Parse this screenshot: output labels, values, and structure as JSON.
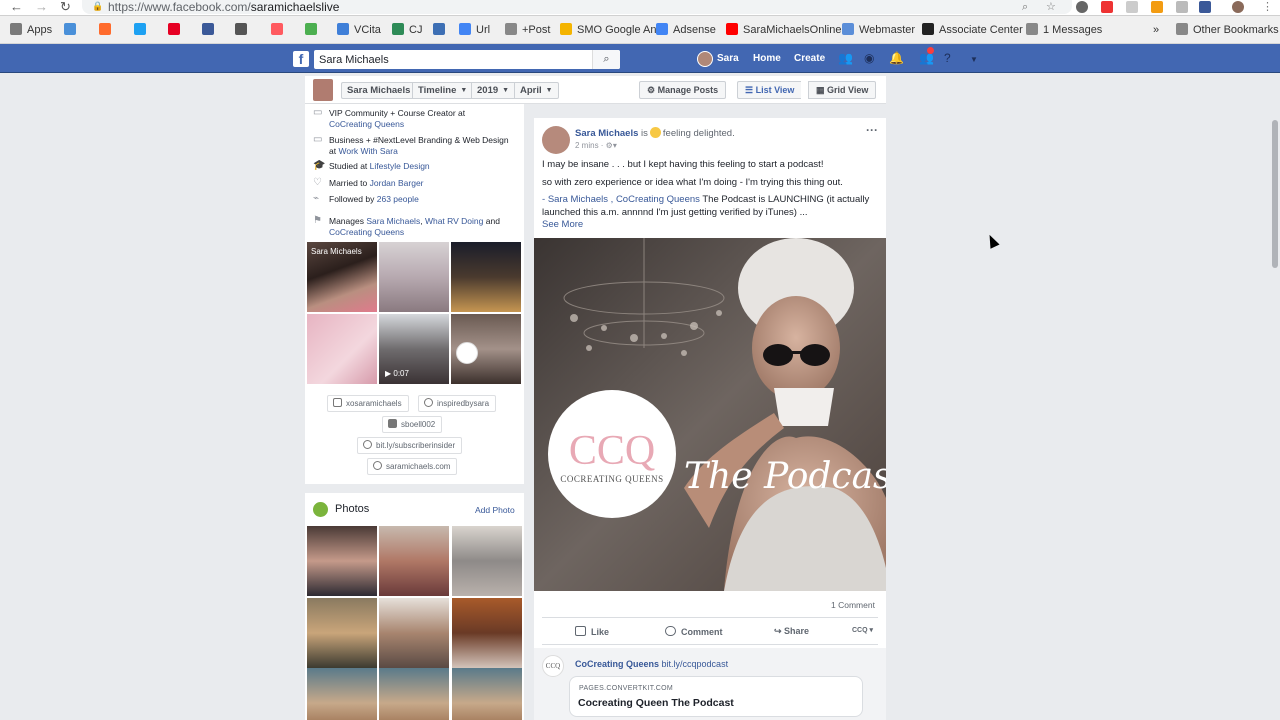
{
  "browser": {
    "url_prefix": "https://www.facebook.com/",
    "url_path": "saramichaelslive",
    "bookmarks": [
      {
        "label": "Apps",
        "color": "#7a7a7a"
      },
      {
        "label": "",
        "color": "#4a90d9"
      },
      {
        "label": "",
        "color": "#ff6b2c"
      },
      {
        "label": "",
        "color": "#1da1f2"
      },
      {
        "label": "",
        "color": "#e60023"
      },
      {
        "label": "",
        "color": "#3b5998"
      },
      {
        "label": "",
        "color": "#555555"
      },
      {
        "label": "",
        "color": "#ff5a5f"
      },
      {
        "label": "",
        "color": "#4caf50"
      },
      {
        "label": "VCita",
        "color": "#3f7fd8"
      },
      {
        "label": "CJ",
        "color": "#2e8b57"
      },
      {
        "label": "",
        "color": "#3d6fb4"
      },
      {
        "label": "Url",
        "color": "#4285f4"
      },
      {
        "label": "+Post",
        "color": "#888888"
      },
      {
        "label": "SMO Google An",
        "color": "#f4b400"
      },
      {
        "label": "Adsense",
        "color": "#4285f4"
      },
      {
        "label": "SaraMichaelsOnline",
        "color": "#ff0000"
      },
      {
        "label": "Webmaster",
        "color": "#5b8ed8"
      },
      {
        "label": "Associate Center",
        "color": "#222222"
      },
      {
        "label": "1 Messages",
        "color": "#888888"
      }
    ],
    "more": "»",
    "other_bookmarks": "Other Bookmarks"
  },
  "fb": {
    "search_value": "Sara Michaels",
    "user_name": "Sara",
    "home": "Home",
    "create": "Create"
  },
  "subheader": {
    "name": "Sara Michaels",
    "timeline": "Timeline",
    "year": "2019",
    "month": "April",
    "manage_posts": "Manage Posts",
    "list_view": "List View",
    "grid_view": "Grid View"
  },
  "intro": {
    "job1_prefix": "VIP Community + Course Creator at",
    "job1_link": "CoCreating Queens",
    "job2_prefix": "Business + #NextLevel Branding & Web Design at",
    "job2_link": "Work With Sara",
    "studied_prefix": "Studied at",
    "studied_link": "Lifestyle Design",
    "married_prefix": "Married to",
    "married_link": "Jordan Barger",
    "followed_prefix": "Followed by",
    "followed_link": "263 people",
    "manages_prefix": "Manages",
    "manages_link1": "Sara Michaels",
    "manages_link2": "What RV Doing",
    "manages_and": "and",
    "manages_link3": "CoCreating Queens"
  },
  "media": {
    "first_label": "Sara Michaels",
    "video_duration": "0:07"
  },
  "social": {
    "instagram": "xosaramichaels",
    "pinterest": "inspiredbysara",
    "youtube": "sboell002",
    "link1": "bit.ly/subscriberinsider",
    "link2": "saramichaels.com"
  },
  "photos": {
    "title": "Photos",
    "add": "Add Photo"
  },
  "post": {
    "author": "Sara Michaels",
    "is": "is",
    "feeling": "feeling delighted.",
    "time": "2 mins · ",
    "line1": "I may be insane . . . but I kept having this feeling to start a podcast!",
    "line2": "so with zero experience or idea what I'm doing - I'm trying this thing out.",
    "line3_dash": "- ",
    "line3_link1": "Sara Michaels",
    "line3_sep": " , ",
    "line3_link2": "CoCreating Queens",
    "line3_rest": " The Podcast is LAUNCHING (it actually launched this a.m. annnnd I'm just getting verified by iTunes) ...",
    "see_more": "See More",
    "image_logo": "CCQ",
    "image_logo_sub": "COCREATING QUEENS",
    "image_script": "The Podcast",
    "comments": "1 Comment",
    "like": "Like",
    "comment": "Comment",
    "share": "Share",
    "comment_author": "CoCreating Queens",
    "comment_link": "bit.ly/ccqpodcast",
    "link_domain": "PAGES.CONVERTKIT.COM",
    "link_title": "Cocreating Queen The Podcast"
  }
}
